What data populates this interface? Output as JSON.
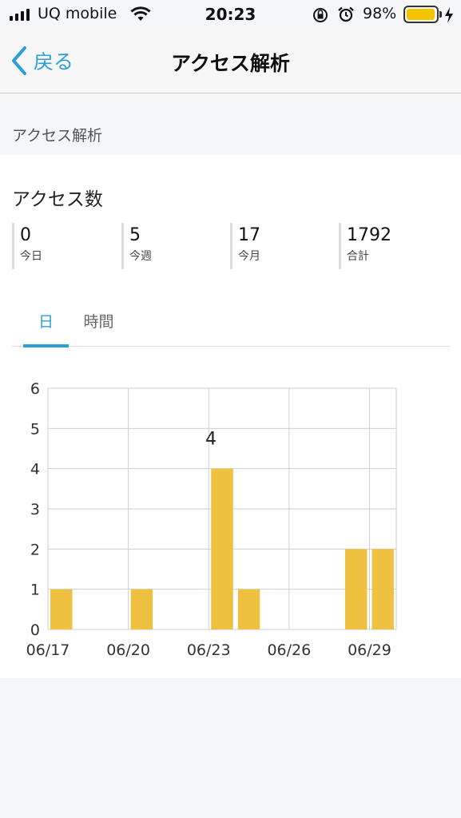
{
  "status_bar": {
    "carrier": "UQ mobile",
    "time": "20:23",
    "battery_percent": "98%",
    "battery_level": 0.98,
    "battery_color": "#f5c400"
  },
  "nav": {
    "back_label": "戻る",
    "title": "アクセス解析",
    "accent_color": "#2c9ed9"
  },
  "section": {
    "title": "アクセス解析"
  },
  "card": {
    "title": "アクセス数",
    "stats": [
      {
        "value": "0",
        "label": "今日"
      },
      {
        "value": "5",
        "label": "今週"
      },
      {
        "value": "17",
        "label": "今月"
      },
      {
        "value": "1792",
        "label": "合計"
      }
    ],
    "tabs": [
      {
        "label": "日",
        "active": true
      },
      {
        "label": "時間",
        "active": false
      }
    ]
  },
  "chart_data": {
    "type": "bar",
    "x": [
      "06/17",
      "06/18",
      "06/19",
      "06/20",
      "06/21",
      "06/22",
      "06/23",
      "06/24",
      "06/25",
      "06/26",
      "06/27",
      "06/28",
      "06/29"
    ],
    "values": [
      1,
      0,
      0,
      1,
      0,
      0,
      4,
      1,
      0,
      0,
      0,
      2,
      2
    ],
    "x_tick_labels": [
      "06/17",
      "06/20",
      "06/23",
      "06/26",
      "06/29"
    ],
    "y_ticks": [
      0,
      1,
      2,
      3,
      4,
      5,
      6
    ],
    "ylim": [
      0,
      6
    ],
    "data_label": {
      "category": "06/23",
      "text": "4"
    },
    "bar_color": "#eec140",
    "grid": true
  }
}
